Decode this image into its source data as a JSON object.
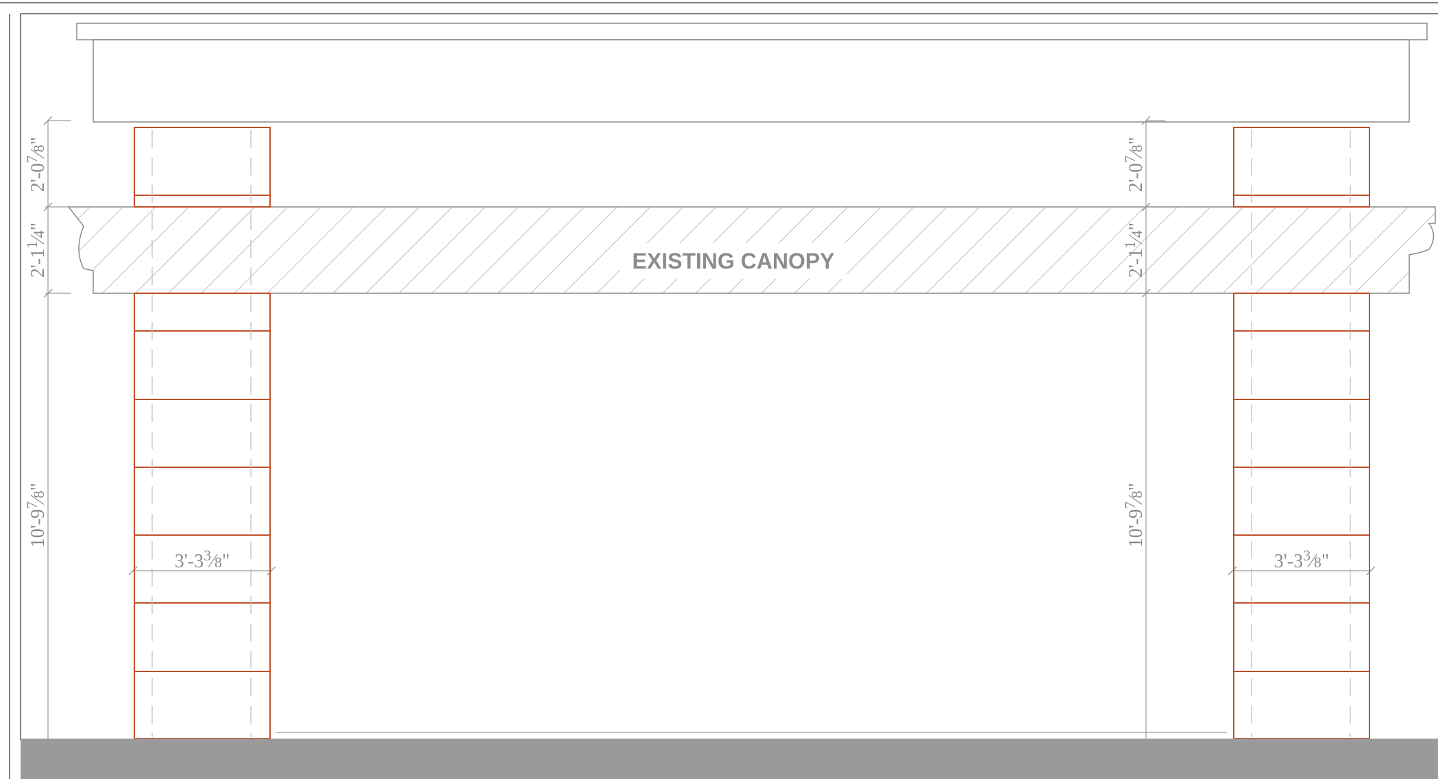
{
  "canopy": {
    "label": "EXISTING CANOPY"
  },
  "dimensions": {
    "upper_left": {
      "main": "2'-0",
      "num": "7",
      "den": "8",
      "unit": "\""
    },
    "upper_right": {
      "main": "2'-0",
      "num": "7",
      "den": "8",
      "unit": "\""
    },
    "canopy_left": {
      "main": "2'-1",
      "num": "1",
      "den": "4",
      "unit": "\""
    },
    "canopy_right": {
      "main": "2'-1",
      "num": "1",
      "den": "4",
      "unit": "\""
    },
    "height_left": {
      "main": "10'-9",
      "num": "7",
      "den": "8",
      "unit": "\""
    },
    "height_right": {
      "main": "10'-9",
      "num": "7",
      "den": "8",
      "unit": "\""
    },
    "width_left": {
      "main": "3'-3",
      "num": "3",
      "den": "8",
      "unit": "\""
    },
    "width_right": {
      "main": "3'-3",
      "num": "3",
      "den": "8",
      "unit": "\""
    }
  },
  "colors": {
    "line": "#8a8a8a",
    "column": "#c0502a",
    "text": "#8c8c8c",
    "ground": "#9a9a9a",
    "hatch": "#9a9a9a"
  }
}
